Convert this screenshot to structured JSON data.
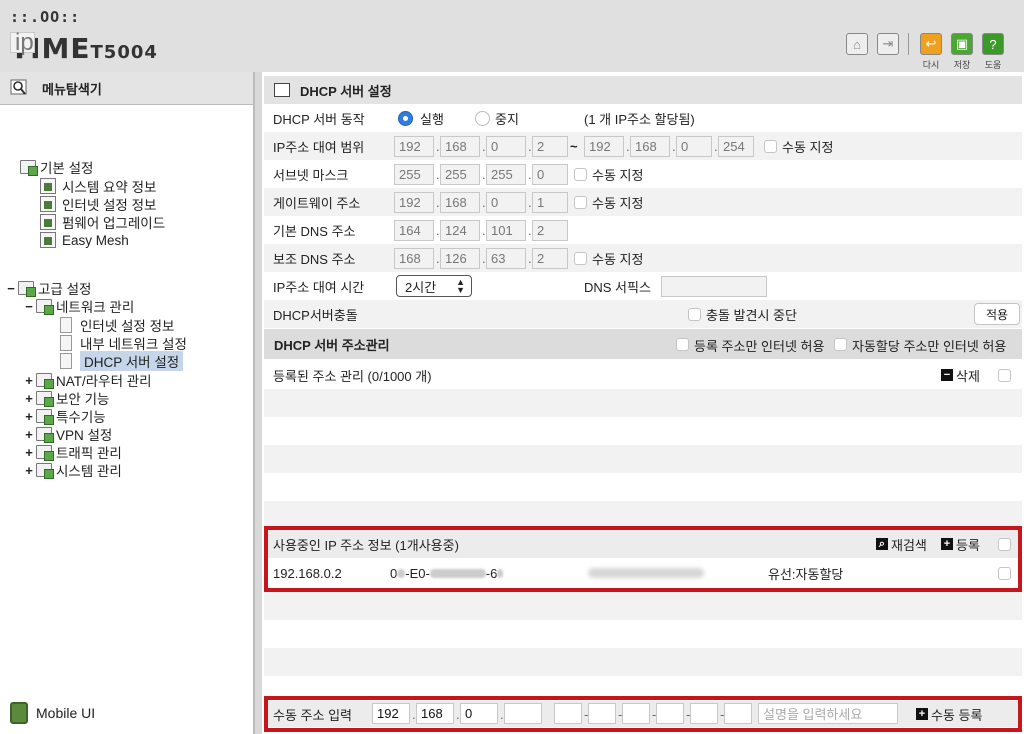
{
  "header": {
    "logo_top": "::.OO::",
    "logo_ip": "ip",
    "logo_time": "TIME",
    "logo_model": "T5004",
    "buttons": [
      {
        "label": "다시",
        "icon": "undo-icon",
        "color": "#f0a020"
      },
      {
        "label": "저장",
        "icon": "save-icon",
        "color": "#4aa832"
      },
      {
        "label": "도움",
        "icon": "help-icon",
        "color": "#3c9a2a"
      }
    ],
    "home_icon": "home-icon",
    "logout_icon": "logout-icon"
  },
  "sidebar": {
    "title": "메뉴탐색기",
    "basic": {
      "label": "기본 설정",
      "items": [
        "시스템 요약 정보",
        "인터넷 설정 정보",
        "펌웨어 업그레이드",
        "Easy Mesh"
      ]
    },
    "advanced": {
      "toggle": "−",
      "label": "고급 설정",
      "network": {
        "toggle": "−",
        "label": "네트워크 관리",
        "items": [
          "인터넷 설정 정보",
          "내부 네트워크 설정",
          "DHCP 서버 설정"
        ]
      },
      "others": [
        "NAT/라우터 관리",
        "보안 기능",
        "특수기능",
        "VPN 설정",
        "트래픽 관리",
        "시스템 관리"
      ],
      "other_toggle": "+"
    },
    "mobile_label": "Mobile UI"
  },
  "main": {
    "title": "DHCP 서버 설정",
    "server_action": {
      "label": "DHCP 서버 동작",
      "run": "실행",
      "stop": "중지",
      "note": "(1 개 IP주소 할당됨)"
    },
    "lease_range": {
      "label": "IP주소 대여 범위",
      "start": [
        "192",
        "168",
        "0",
        "2"
      ],
      "tilde": "~",
      "end": [
        "192",
        "168",
        "0",
        "254"
      ],
      "manual": "수동 지정"
    },
    "subnet": {
      "label": "서브넷 마스크",
      "value": [
        "255",
        "255",
        "255",
        "0"
      ],
      "manual": "수동 지정"
    },
    "gateway": {
      "label": "게이트웨이 주소",
      "value": [
        "192",
        "168",
        "0",
        "1"
      ],
      "manual": "수동 지정"
    },
    "dns1": {
      "label": "기본 DNS 주소",
      "value": [
        "164",
        "124",
        "101",
        "2"
      ]
    },
    "dns2": {
      "label": "보조 DNS 주소",
      "value": [
        "168",
        "126",
        "63",
        "2"
      ],
      "manual": "수동 지정"
    },
    "lease_time": {
      "label": "IP주소 대여 시간",
      "value": "2시간",
      "dns_suffix_label": "DNS 서픽스",
      "dns_suffix_value": ""
    },
    "conflict": {
      "label": "DHCP서버충돌",
      "stop_label": "충돌 발견시 중단",
      "apply": "적용"
    },
    "addr_mgmt": {
      "title": "DHCP 서버 주소관리",
      "registered_only": "등록 주소만 인터넷 허용",
      "auto_only": "자동할당 주소만 인터넷 허용",
      "registered": "등록된 주소 관리 (0/1000 개)",
      "delete": "삭제"
    },
    "in_use": {
      "title": "사용중인 IP 주소 정보 (1개사용중)",
      "rescan": "재검색",
      "register": "등록",
      "row": {
        "ip": "192.168.0.2",
        "mac_a": "0",
        "mac_b": "-E0-",
        "mac_c": "-6",
        "type": "유선:자동할당"
      }
    },
    "manual_input": {
      "label": "수동 주소 입력",
      "ip": [
        "192",
        "168",
        "0",
        ""
      ],
      "desc_placeholder": "설명을 입력하세요",
      "register": "수동 등록"
    }
  }
}
